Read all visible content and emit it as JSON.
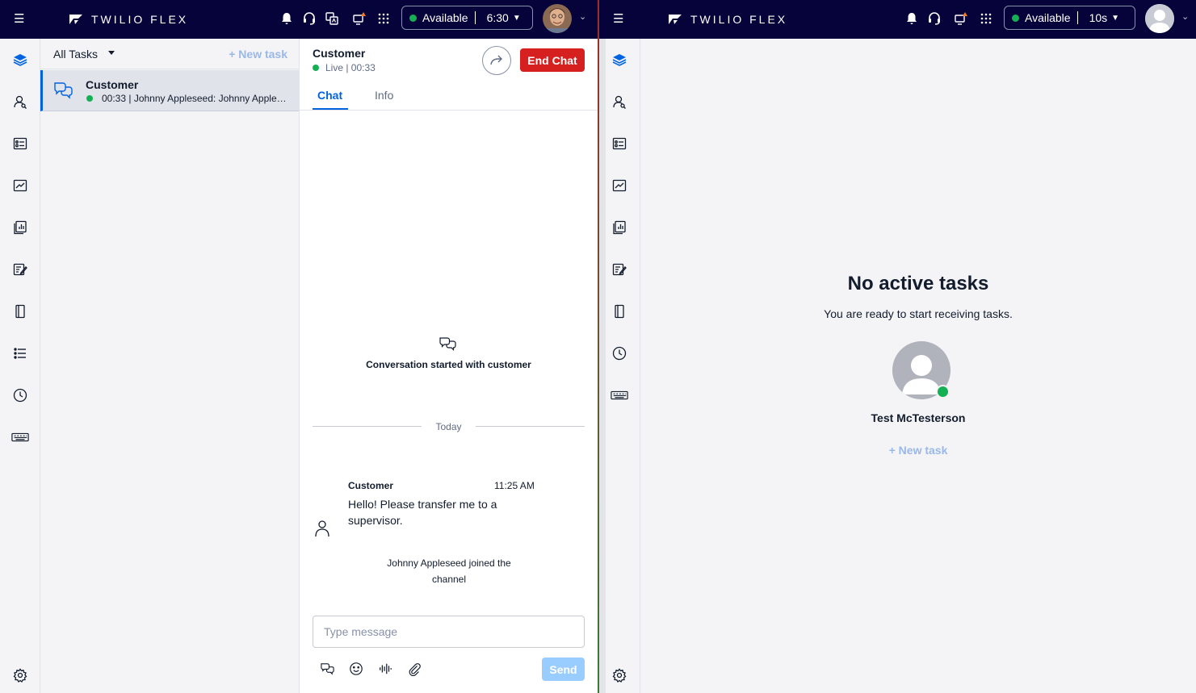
{
  "colors": {
    "topbar": "#06033a",
    "accent": "#0263e0",
    "available": "#14b053",
    "danger": "#d61f1f",
    "link_disabled": "#99b8e8"
  },
  "left": {
    "brand": "TWILIO FLEX",
    "status": {
      "label": "Available",
      "timer": "6:30"
    },
    "tasklist": {
      "filter_label": "All Tasks",
      "new_task_label": "+ New task",
      "tasks": [
        {
          "name": "Customer",
          "subtitle": "00:33 | Johnny Appleseed: Johnny Appleseed joined the channel"
        }
      ]
    },
    "chat": {
      "title": "Customer",
      "live": "Live | 00:33",
      "end_chat_label": "End Chat",
      "tabs": [
        {
          "label": "Chat"
        },
        {
          "label": "Info"
        }
      ],
      "conversation_started": "Conversation started with customer",
      "date_divider": "Today",
      "message": {
        "author": "Customer",
        "time": "11:25 AM",
        "text": "Hello! Please transfer me to a supervisor."
      },
      "system_message": "Johnny Appleseed joined the channel",
      "input_placeholder": "Type message",
      "send_label": "Send"
    }
  },
  "right": {
    "brand": "TWILIO FLEX",
    "status": {
      "label": "Available",
      "timer": "10s"
    },
    "empty": {
      "title": "No active tasks",
      "subtitle": "You are ready to start receiving tasks.",
      "agent_name": "Test McTesterson",
      "new_task_label": "+ New task"
    }
  }
}
